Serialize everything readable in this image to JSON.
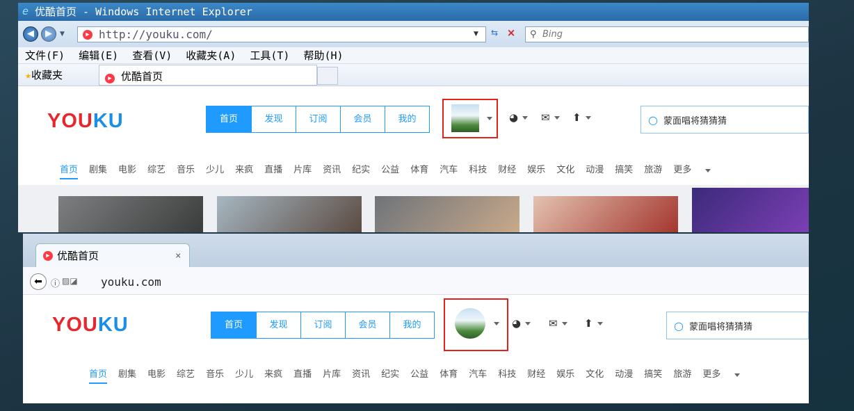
{
  "ie": {
    "title": "优酷首页 - Windows Internet Explorer",
    "url": "http://youku.com/",
    "search_placeholder": "Bing",
    "menu": [
      "文件(F)",
      "编辑(E)",
      "查看(V)",
      "收藏夹(A)",
      "工具(T)",
      "帮助(H)"
    ],
    "favorites_label": "收藏夹",
    "tab_label": "优酷首页"
  },
  "ff": {
    "tab_label": "优酷首页",
    "tab_close": "×",
    "url": "youku.com"
  },
  "youku": {
    "logo_a": "YOU",
    "logo_b": "KU",
    "nav_tabs": [
      "首页",
      "发现",
      "订阅",
      "会员",
      "我的"
    ],
    "search_value": "蒙面唱将猜猜猜",
    "categories": [
      "首页",
      "剧集",
      "电影",
      "综艺",
      "音乐",
      "少儿",
      "来疯",
      "直播",
      "片库",
      "资讯",
      "纪实",
      "公益",
      "体育",
      "汽车",
      "科技",
      "财经",
      "娱乐",
      "文化",
      "动漫",
      "搞笑",
      "旅游",
      "更多"
    ]
  },
  "colors": {
    "accent": "#1f9bff",
    "highlight": "#e3221c",
    "logo_red": "#e8262e",
    "logo_blue": "#1a8fe8"
  },
  "icons": [
    "ie-logo-icon",
    "back-icon",
    "forward-icon",
    "youku-favicon-icon",
    "refresh-icon",
    "stop-icon",
    "search-icon",
    "star-icon",
    "history-icon",
    "mail-icon",
    "upload-icon",
    "chevron-down-icon",
    "info-icon",
    "tracking-icon"
  ]
}
